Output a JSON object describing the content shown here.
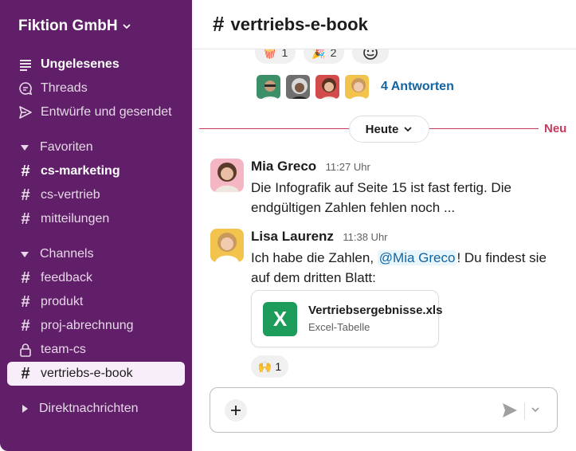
{
  "sidebar": {
    "workspace": "Fiktion GmbH",
    "top_items": [
      {
        "label": "Ungelesenes"
      },
      {
        "label": "Threads"
      },
      {
        "label": "Entwürfe und gesendet"
      }
    ],
    "favorites_label": "Favoriten",
    "favorites": [
      "cs-marketing",
      "cs-vertrieb",
      "mitteilungen"
    ],
    "channels_label": "Channels",
    "channels": [
      "feedback",
      "produkt",
      "proj-abrechnung",
      "team-cs",
      "vertriebs-e-book"
    ],
    "dm_label": "Direktnachrichten"
  },
  "header": {
    "hash": "#",
    "title": "vertriebs-e-book"
  },
  "top_reactions": [
    {
      "emoji": "🍿",
      "count": "1"
    },
    {
      "emoji": "🎉",
      "count": "2"
    }
  ],
  "thread": {
    "replies": "4 Antworten"
  },
  "divider": {
    "label": "Heute",
    "new_label": "Neu"
  },
  "messages": [
    {
      "name": "Mia Greco",
      "time": "11:27 Uhr",
      "text": "Die Infografik auf Seite 15 ist fast fertig. Die endgültigen Zahlen fehlen noch ..."
    },
    {
      "name": "Lisa Laurenz",
      "time": "11:38 Uhr",
      "text_before": "Ich habe die Zahlen, ",
      "mention": "@Mia Greco",
      "text_after": "! Du findest sie auf dem dritten Blatt:"
    }
  ],
  "attachment": {
    "icon_letter": "X",
    "name": "Vertriebsergebnisse.xls",
    "type": "Excel-Tabelle"
  },
  "bottom_reaction": {
    "emoji": "🙌",
    "count": "1"
  },
  "composer": {
    "placeholder": ""
  },
  "colors": {
    "sidebar": "#611f69",
    "accent_red": "#c63a5d",
    "link": "#1264a3",
    "excel": "#1d9b5b"
  }
}
